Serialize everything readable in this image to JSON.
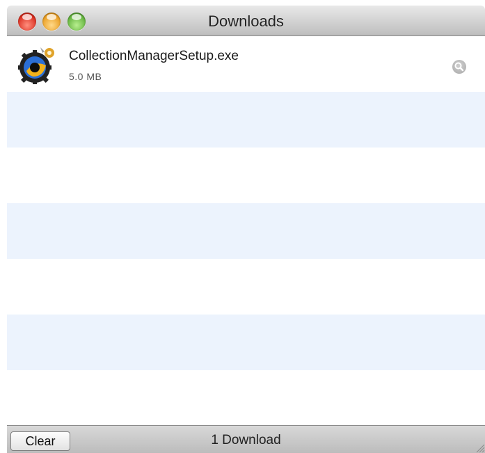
{
  "window": {
    "title": "Downloads"
  },
  "downloads": [
    {
      "filename": "CollectionManagerSetup.exe",
      "size": "5.0 MB",
      "icon": "installer-app-icon",
      "action_icon": "magnifier-icon"
    }
  ],
  "footer": {
    "clear_label": "Clear",
    "count_label": "1 Download"
  },
  "colors": {
    "stripe": "#ecf3fd",
    "row": "#ffffff"
  }
}
